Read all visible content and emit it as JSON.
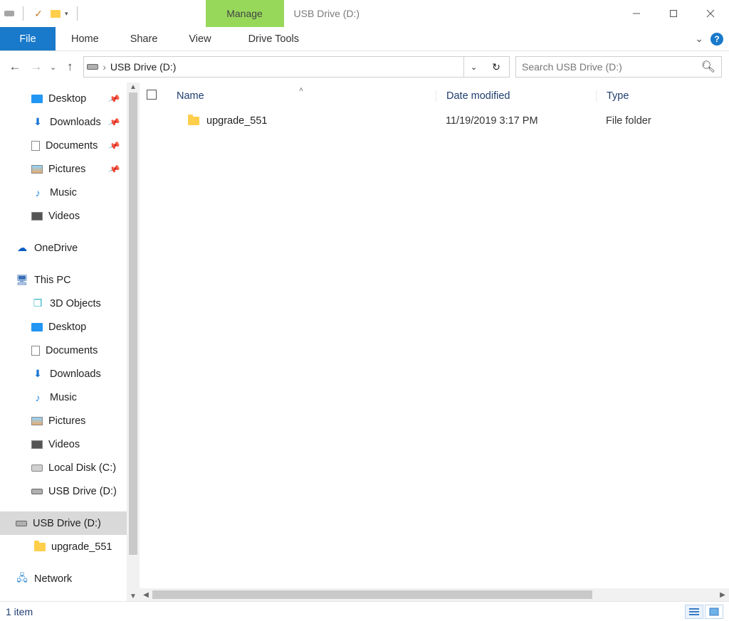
{
  "titlebar": {
    "context_tab": "Manage",
    "window_title": "USB Drive (D:)"
  },
  "ribbon": {
    "file": "File",
    "tabs": [
      "Home",
      "Share",
      "View",
      "Drive Tools"
    ]
  },
  "address": {
    "location": "USB Drive (D:)"
  },
  "search": {
    "placeholder": "Search USB Drive (D:)"
  },
  "nav_tree": {
    "quick": [
      {
        "label": "Desktop",
        "icon": "desktop",
        "pinned": true
      },
      {
        "label": "Downloads",
        "icon": "dl",
        "pinned": true
      },
      {
        "label": "Documents",
        "icon": "docs",
        "pinned": true
      },
      {
        "label": "Pictures",
        "icon": "pic",
        "pinned": true
      },
      {
        "label": "Music",
        "icon": "music",
        "pinned": false
      },
      {
        "label": "Videos",
        "icon": "video",
        "pinned": false
      }
    ],
    "onedrive": "OneDrive",
    "this_pc": "This PC",
    "this_pc_children": [
      {
        "label": "3D Objects",
        "icon": "3d"
      },
      {
        "label": "Desktop",
        "icon": "desktop"
      },
      {
        "label": "Documents",
        "icon": "docs"
      },
      {
        "label": "Downloads",
        "icon": "dl"
      },
      {
        "label": "Music",
        "icon": "music"
      },
      {
        "label": "Pictures",
        "icon": "pic"
      },
      {
        "label": "Videos",
        "icon": "video"
      },
      {
        "label": "Local Disk (C:)",
        "icon": "disk"
      },
      {
        "label": "USB Drive (D:)",
        "icon": "usb"
      }
    ],
    "root_usb": "USB Drive (D:)",
    "root_usb_child": "upgrade_551",
    "network": "Network"
  },
  "columns": {
    "name": "Name",
    "date": "Date modified",
    "type": "Type"
  },
  "rows": [
    {
      "name": "upgrade_551",
      "date": "11/19/2019 3:17 PM",
      "type": "File folder"
    }
  ],
  "statusbar": {
    "count": "1 item"
  }
}
